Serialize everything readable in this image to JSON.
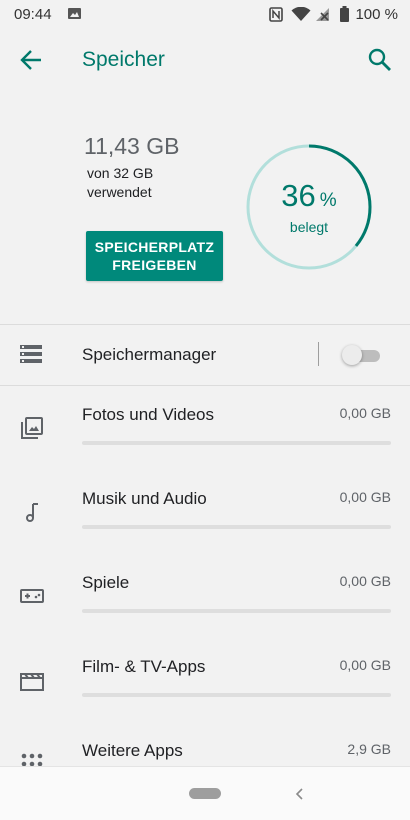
{
  "status_bar": {
    "time": "09:44",
    "battery_text": "100 %",
    "icons": [
      "image-icon",
      "nfc-icon",
      "wifi-icon",
      "signal-icon",
      "battery-icon"
    ]
  },
  "app_bar": {
    "title": "Speicher",
    "back_icon": "arrow-back-icon",
    "search_icon": "search-icon"
  },
  "summary": {
    "used_amount": "11,43 GB",
    "of_total": "von 32 GB",
    "used_label": "verwendet",
    "free_button_label": "SPEICHERPLATZ FREIGEBEN",
    "percent_value": "36",
    "percent_sign": "%",
    "ring_label": "belegt",
    "used_fraction": 0.36
  },
  "manager": {
    "label": "Speichermanager",
    "icon": "storage-list-icon",
    "toggle_on": false
  },
  "categories": [
    {
      "label": "Fotos und Videos",
      "size": "0,00 GB",
      "icon": "photo-library-icon",
      "fraction": 0
    },
    {
      "label": "Musik und Audio",
      "size": "0,00 GB",
      "icon": "music-note-icon",
      "fraction": 0
    },
    {
      "label": "Spiele",
      "size": "0,00 GB",
      "icon": "gamepad-icon",
      "fraction": 0
    },
    {
      "label": "Film- & TV-Apps",
      "size": "0,00 GB",
      "icon": "movie-icon",
      "fraction": 0
    },
    {
      "label": "Weitere Apps",
      "size": "2,9 GB",
      "icon": "apps-grid-icon",
      "fraction": 0.09
    }
  ],
  "colors": {
    "accent": "#00796b",
    "button": "#00897b",
    "ring_track": "#b2dfdb",
    "background": "#f2f2f2"
  }
}
